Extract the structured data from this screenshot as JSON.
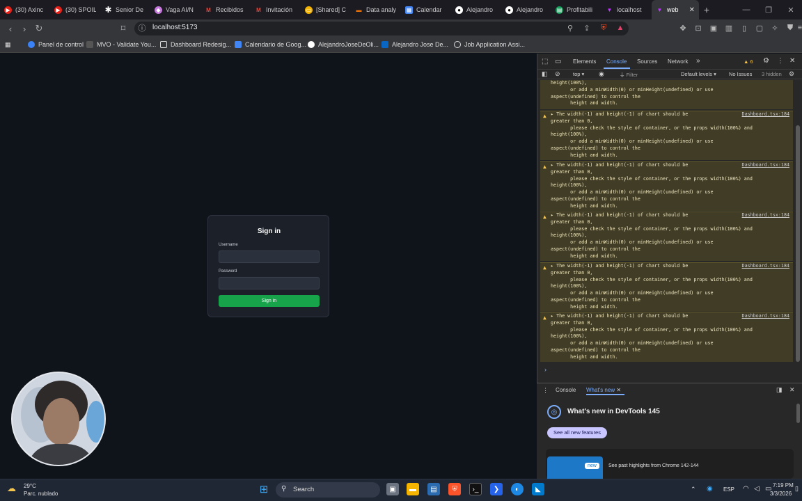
{
  "browser": {
    "tabs": [
      {
        "label": "(30) Axinc",
        "icon": "youtube-icon",
        "color": "#e62117"
      },
      {
        "label": "(30) SPOIL",
        "icon": "youtube-icon",
        "color": "#e62117"
      },
      {
        "label": "Senior De",
        "icon": "asterisk-icon",
        "color": "#ffffff"
      },
      {
        "label": "Vaga AI/N",
        "icon": "app-icon",
        "color": "#c678dd"
      },
      {
        "label": "Recibidos",
        "icon": "gmail-icon",
        "color": "#ea4335"
      },
      {
        "label": "Invitación",
        "icon": "gmail-icon",
        "color": "#ea4335"
      },
      {
        "label": "[Shared] C",
        "icon": "slides-icon",
        "color": "#f4b400"
      },
      {
        "label": "Data analy",
        "icon": "chart-icon",
        "color": "#e8710a"
      },
      {
        "label": "Calendar",
        "icon": "calendar-icon",
        "color": "#4285f4"
      },
      {
        "label": "Alejandro",
        "icon": "github-icon",
        "color": "#ffffff"
      },
      {
        "label": "Alejandro",
        "icon": "github-icon",
        "color": "#ffffff"
      },
      {
        "label": "Profitabili",
        "icon": "sheets-icon",
        "color": "#0f9d58"
      },
      {
        "label": "localhost",
        "icon": "vite-icon",
        "color": "#bd34fe"
      },
      {
        "label": "web",
        "icon": "vite-icon",
        "color": "#bd34fe",
        "active": true
      }
    ],
    "url": "localhost:5173",
    "bookmarks": [
      {
        "label": "Panel de control",
        "color": "#3b82f6"
      },
      {
        "label": "MVO - Validate You...",
        "color": "#888888"
      },
      {
        "label": "Dashboard Redesig...",
        "color": "#ffffff"
      },
      {
        "label": "Calendario de Goog...",
        "color": "#4285f4"
      },
      {
        "label": "AlejandroJoseDeOli...",
        "color": "#ffffff"
      },
      {
        "label": "Alejandro Jose De...",
        "color": "#0a66c2"
      },
      {
        "label": "Job Application Assi...",
        "color": "#ffffff"
      }
    ]
  },
  "login": {
    "title": "Sign in",
    "username_label": "Username",
    "username_value": "",
    "password_label": "Password",
    "password_value": "",
    "button_label": "Sign in",
    "button_color": "#16a34a"
  },
  "devtools": {
    "tabs": [
      "Elements",
      "Console",
      "Sources",
      "Network"
    ],
    "active_tab": "Console",
    "warning_count": "6",
    "context": "top",
    "filter_placeholder": "Filter",
    "levels": "Default levels",
    "issues": "No Issues",
    "hidden": "3 hidden",
    "partial_message": "height(100%),\n       or add a minWidth(0) or minHeight(undefined) or use\naspect(undefined) to control the\n       height and width.",
    "warnings": [
      {
        "message": "The width(-1) and height(-1) of chart should be\ngreater than 0,\n       please check the style of container, or the props width(100%) and\nheight(100%),\n       or add a minWidth(0) or minHeight(undefined) or use\naspect(undefined) to control the\n       height and width.",
        "source": "Dashboard.tsx:184"
      },
      {
        "message": "The width(-1) and height(-1) of chart should be\ngreater than 0,\n       please check the style of container, or the props width(100%) and\nheight(100%),\n       or add a minWidth(0) or minHeight(undefined) or use\naspect(undefined) to control the\n       height and width.",
        "source": "Dashboard.tsx:184"
      },
      {
        "message": "The width(-1) and height(-1) of chart should be\ngreater than 0,\n       please check the style of container, or the props width(100%) and\nheight(100%),\n       or add a minWidth(0) or minHeight(undefined) or use\naspect(undefined) to control the\n       height and width.",
        "source": "Dashboard.tsx:184"
      },
      {
        "message": "The width(-1) and height(-1) of chart should be\ngreater than 0,\n       please check the style of container, or the props width(100%) and\nheight(100%),\n       or add a minWidth(0) or minHeight(undefined) or use\naspect(undefined) to control the\n       height and width.",
        "source": "Dashboard.tsx:184"
      },
      {
        "message": "The width(-1) and height(-1) of chart should be\ngreater than 0,\n       please check the style of container, or the props width(100%) and\nheight(100%),\n       or add a minWidth(0) or minHeight(undefined) or use\naspect(undefined) to control the\n       height and width.",
        "source": "Dashboard.tsx:184"
      }
    ],
    "drawer": {
      "tabs": [
        "Console",
        "What's new"
      ],
      "active_tab": "What's new",
      "title": "What's new in DevTools 145",
      "button": "See all new features",
      "highlights_text": "See past highlights from Chrome 142-144",
      "badge": "new"
    }
  },
  "taskbar": {
    "weather_temp": "29°C",
    "weather_desc": "Parc. nublado",
    "search_label": "Search",
    "language": "ESP",
    "time": "7:19 PM",
    "date": "3/3/2026"
  }
}
